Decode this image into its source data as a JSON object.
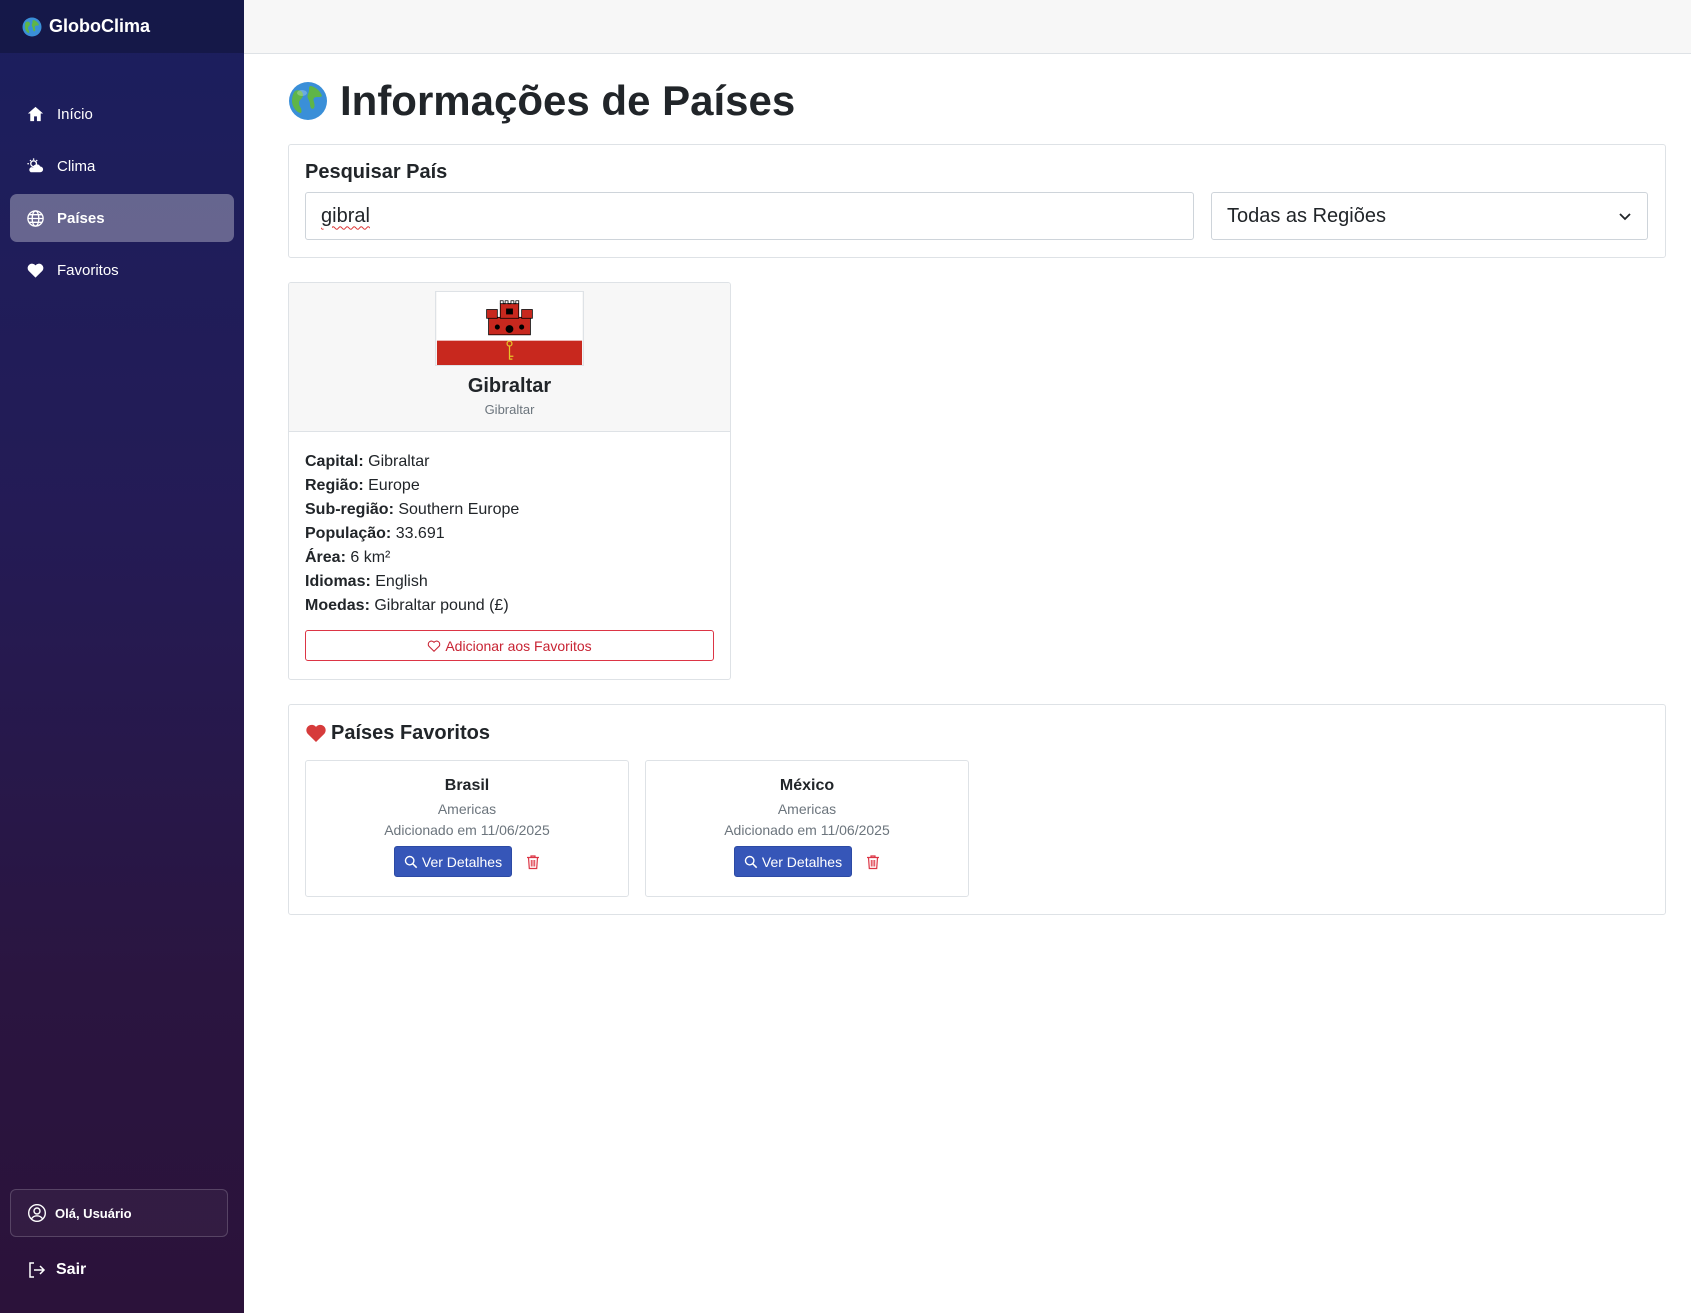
{
  "app": {
    "name": "GloboClima"
  },
  "sidebar": {
    "items": [
      {
        "label": "Início",
        "icon": "home-icon"
      },
      {
        "label": "Clima",
        "icon": "cloud-sun-icon"
      },
      {
        "label": "Países",
        "icon": "globe-icon",
        "active": true
      },
      {
        "label": "Favoritos",
        "icon": "heart-icon"
      }
    ],
    "user_greeting": "Olá, Usuário",
    "logout_label": "Sair"
  },
  "page": {
    "title": "Informações de Países"
  },
  "search": {
    "label": "Pesquisar País",
    "query": "gibral",
    "region_selected": "Todas as Regiões"
  },
  "country": {
    "name": "Gibraltar",
    "native_name": "Gibraltar",
    "fields": [
      {
        "label": "Capital:",
        "value": "Gibraltar"
      },
      {
        "label": "Região:",
        "value": "Europe"
      },
      {
        "label": "Sub-região:",
        "value": "Southern Europe"
      },
      {
        "label": "População:",
        "value": "33.691"
      },
      {
        "label": "Área:",
        "value": "6 km²"
      },
      {
        "label": "Idiomas:",
        "value": "English"
      },
      {
        "label": "Moedas:",
        "value": "Gibraltar pound (£)"
      }
    ],
    "favorite_button": "Adicionar aos Favoritos"
  },
  "favorites": {
    "title": "Países Favoritos",
    "items": [
      {
        "name": "Brasil",
        "region": "Americas",
        "added": "Adicionado em 11/06/2025",
        "details_label": "Ver Detalhes"
      },
      {
        "name": "México",
        "region": "Americas",
        "added": "Adicionado em 11/06/2025",
        "details_label": "Ver Detalhes"
      }
    ]
  },
  "colors": {
    "sidebar_top": "#1b1f5e",
    "sidebar_bottom": "#2b123a",
    "primary": "#3656b8",
    "danger": "#dc3545"
  }
}
